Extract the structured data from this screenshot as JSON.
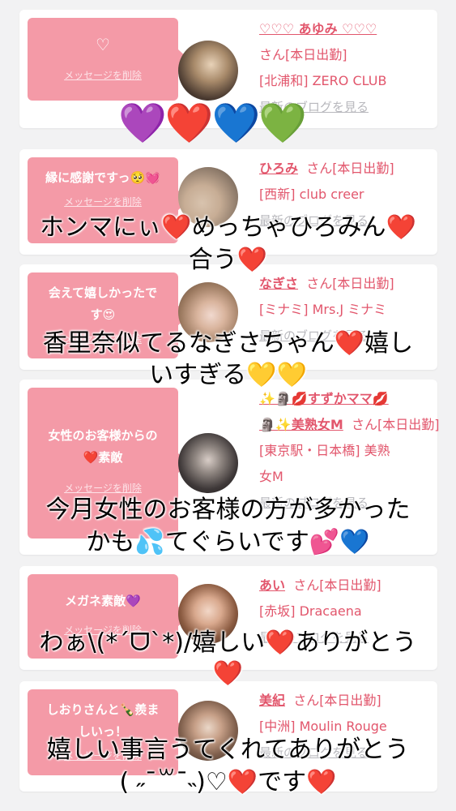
{
  "cards": [
    {
      "message": "♡",
      "delete_label": "メッセージを削除",
      "name": "♡♡♡ あゆみ ♡♡♡",
      "suffix": "さん[本日出勤]",
      "area_shop": "[北浦和] ZERO CLUB",
      "blog_label": "最新のブログを見る"
    },
    {
      "message": "縁に感謝ですっ🥺💓",
      "delete_label": "メッセージを削除",
      "name": "ひろみ",
      "suffix": "さん[本日出勤]",
      "area_shop": "[西新] club creer",
      "blog_label": "最新のブログを見る"
    },
    {
      "message": "会えて嬉しかったです😍",
      "delete_label": "メッセージを削除",
      "name": "なぎさ",
      "suffix": "さん[本日出勤]",
      "area_shop": "[ミナミ] Mrs.J ミナミ",
      "blog_label": "最新のブログを見る"
    },
    {
      "message": "女性のお客様からの❤️素敵",
      "delete_label": "メッセージを削除",
      "name_line1": "✨🗿💋すずかママ💋",
      "name_line2": "🗿✨美熟女M",
      "suffix": "さん[本日出勤]",
      "area_shop_line1": "[東京駅・日本橋] 美熟",
      "area_shop_line2": "女M",
      "blog_label": "最新のブログを見る"
    },
    {
      "message": "メガネ素敵💜",
      "delete_label": "メッセージを削除",
      "name": "あい",
      "suffix": "さん[本日出勤]",
      "area_shop": "[赤坂] Dracaena",
      "blog_label": "最新のブログを見る"
    },
    {
      "message": "しおりさんと🍾羨ましいっ！",
      "delete_label": "メッセージを削除",
      "name": "美紀",
      "suffix": "さん[本日出勤]",
      "area_shop": "[中洲] Moulin Rouge",
      "blog_label": "最新のブログを見る"
    }
  ],
  "stickers": {
    "hearts": [
      "💜",
      "❤️",
      "💙",
      "💚"
    ],
    "captions": [
      "ホンマにぃ❤️めっちゃひろみん❤️",
      "合う❤️",
      "香里奈似てるなぎさちゃん❤️嬉し",
      "いすぎる💛💛",
      "今月女性のお客様の方が多かった",
      "かも💦てぐらいです💕💙",
      "わぁ\\(*´ᗜ`*)/嬉しい❤️ありがとう",
      "❤️",
      "嬉しい事言うてくれてありがとう",
      "( ˶¯꒳¯˵)♡❤️です❤️"
    ]
  },
  "colors": {
    "bubble": "#f49aa7",
    "accent": "#e2566c",
    "background": "#f2f2f3",
    "link_gray": "#b8b8bd"
  }
}
